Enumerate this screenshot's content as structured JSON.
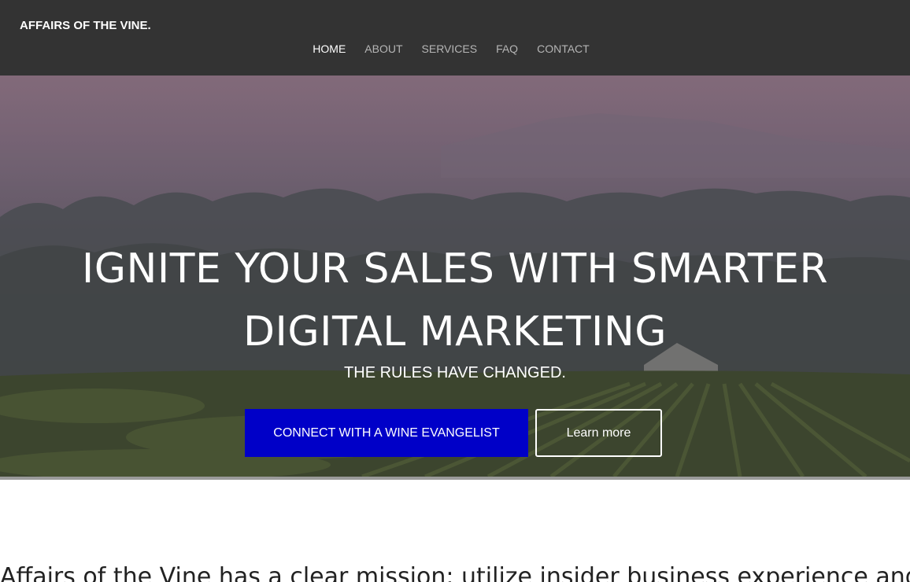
{
  "header": {
    "brand": "AFFAIRS OF THE VINE.",
    "nav": [
      {
        "label": "HOME",
        "active": true
      },
      {
        "label": "ABOUT",
        "active": false
      },
      {
        "label": "SERVICES",
        "active": false
      },
      {
        "label": "FAQ",
        "active": false
      },
      {
        "label": "CONTACT",
        "active": false
      }
    ]
  },
  "hero": {
    "headline_line1": "IGNITE YOUR SALES WITH SMARTER",
    "headline_line2": "DIGITAL MARKETING",
    "subheadline": "THE RULES HAVE CHANGED.",
    "primary_button": "CONNECT WITH A WINE EVANGELIST",
    "secondary_button": "Learn more"
  },
  "intro": {
    "mission_text": "Affairs of the Vine has a clear mission: utilize insider business experience and"
  },
  "colors": {
    "header_bg": "#333333",
    "primary_button": "#0000c8",
    "nav_active": "#ffffff",
    "nav_inactive": "#b5b5b5"
  }
}
